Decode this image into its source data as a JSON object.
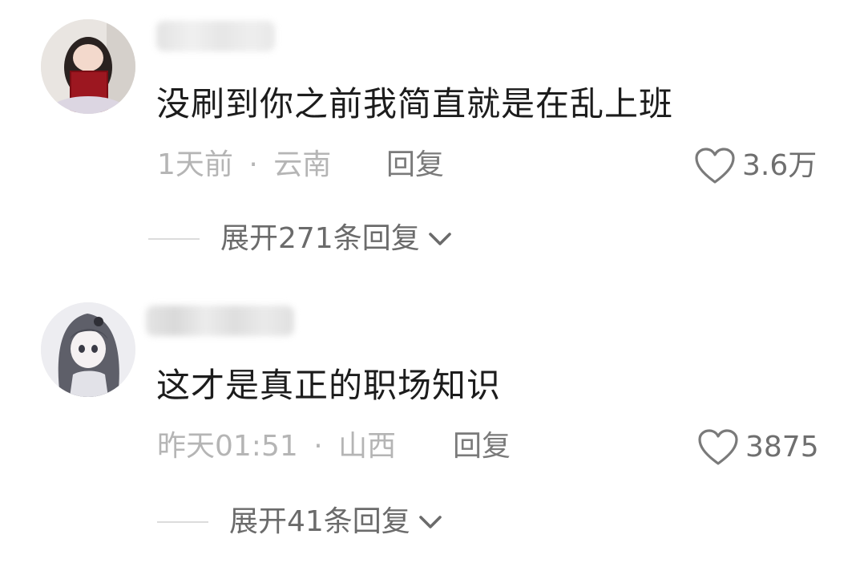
{
  "comments": [
    {
      "text": "没刷到你之前我简直就是在乱上班",
      "time": "1天前",
      "separator": "·",
      "location": "云南",
      "reply_label": "回复",
      "likes": "3.6万",
      "expand_label": "展开271条回复"
    },
    {
      "text": "这才是真正的职场知识",
      "time": "昨天01:51",
      "separator": "·",
      "location": "山西",
      "reply_label": "回复",
      "likes": "3875",
      "expand_label": "展开41条回复"
    }
  ],
  "icons": {
    "like": "heart-outline-icon",
    "expand": "chevron-down-icon"
  },
  "colors": {
    "text": "#1c1c1c",
    "meta": "#b5b5b5",
    "action": "#6f6f6f"
  }
}
